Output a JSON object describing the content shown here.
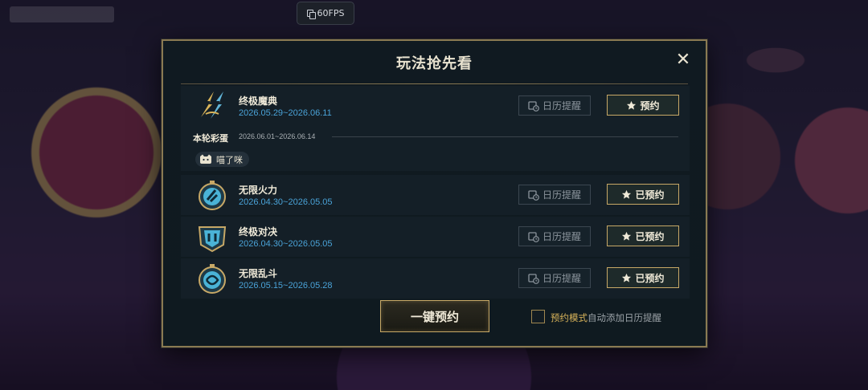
{
  "overlay": {
    "fps_label": "60FPS"
  },
  "modal": {
    "title": "玩法抢先看",
    "close_symbol": "✕",
    "calendar_label": "日历提醒",
    "featured": {
      "name": "终极魔典",
      "date_range": "2026.05.29~2026.06.11",
      "reserve_label": "预约",
      "egg_label": "本轮彩蛋",
      "egg_date_range": "2026.06.01~2026.06.14",
      "egg_chip": "喵了咪",
      "icon": "lightning-bolt-icon"
    },
    "modes": [
      {
        "name": "无限火力",
        "date_range": "2026.04.30~2026.05.05",
        "reserve_label": "已预约",
        "icon": "urf-icon"
      },
      {
        "name": "终极对决",
        "date_range": "2026.04.30~2026.05.05",
        "reserve_label": "已预约",
        "icon": "ultimate-duel-icon"
      },
      {
        "name": "无限乱斗",
        "date_range": "2026.05.15~2026.05.28",
        "reserve_label": "已预约",
        "icon": "infinite-brawl-icon"
      }
    ],
    "bulk_reserve_label": "一键预约",
    "auto_add": {
      "highlight": "预约模式",
      "rest": "自动添加日历提醒",
      "checked": false
    }
  },
  "colors": {
    "gold": "#c7a866",
    "date_blue": "#4aa3d8",
    "panel_bg": "#101a21",
    "row_bg": "#141f27"
  }
}
